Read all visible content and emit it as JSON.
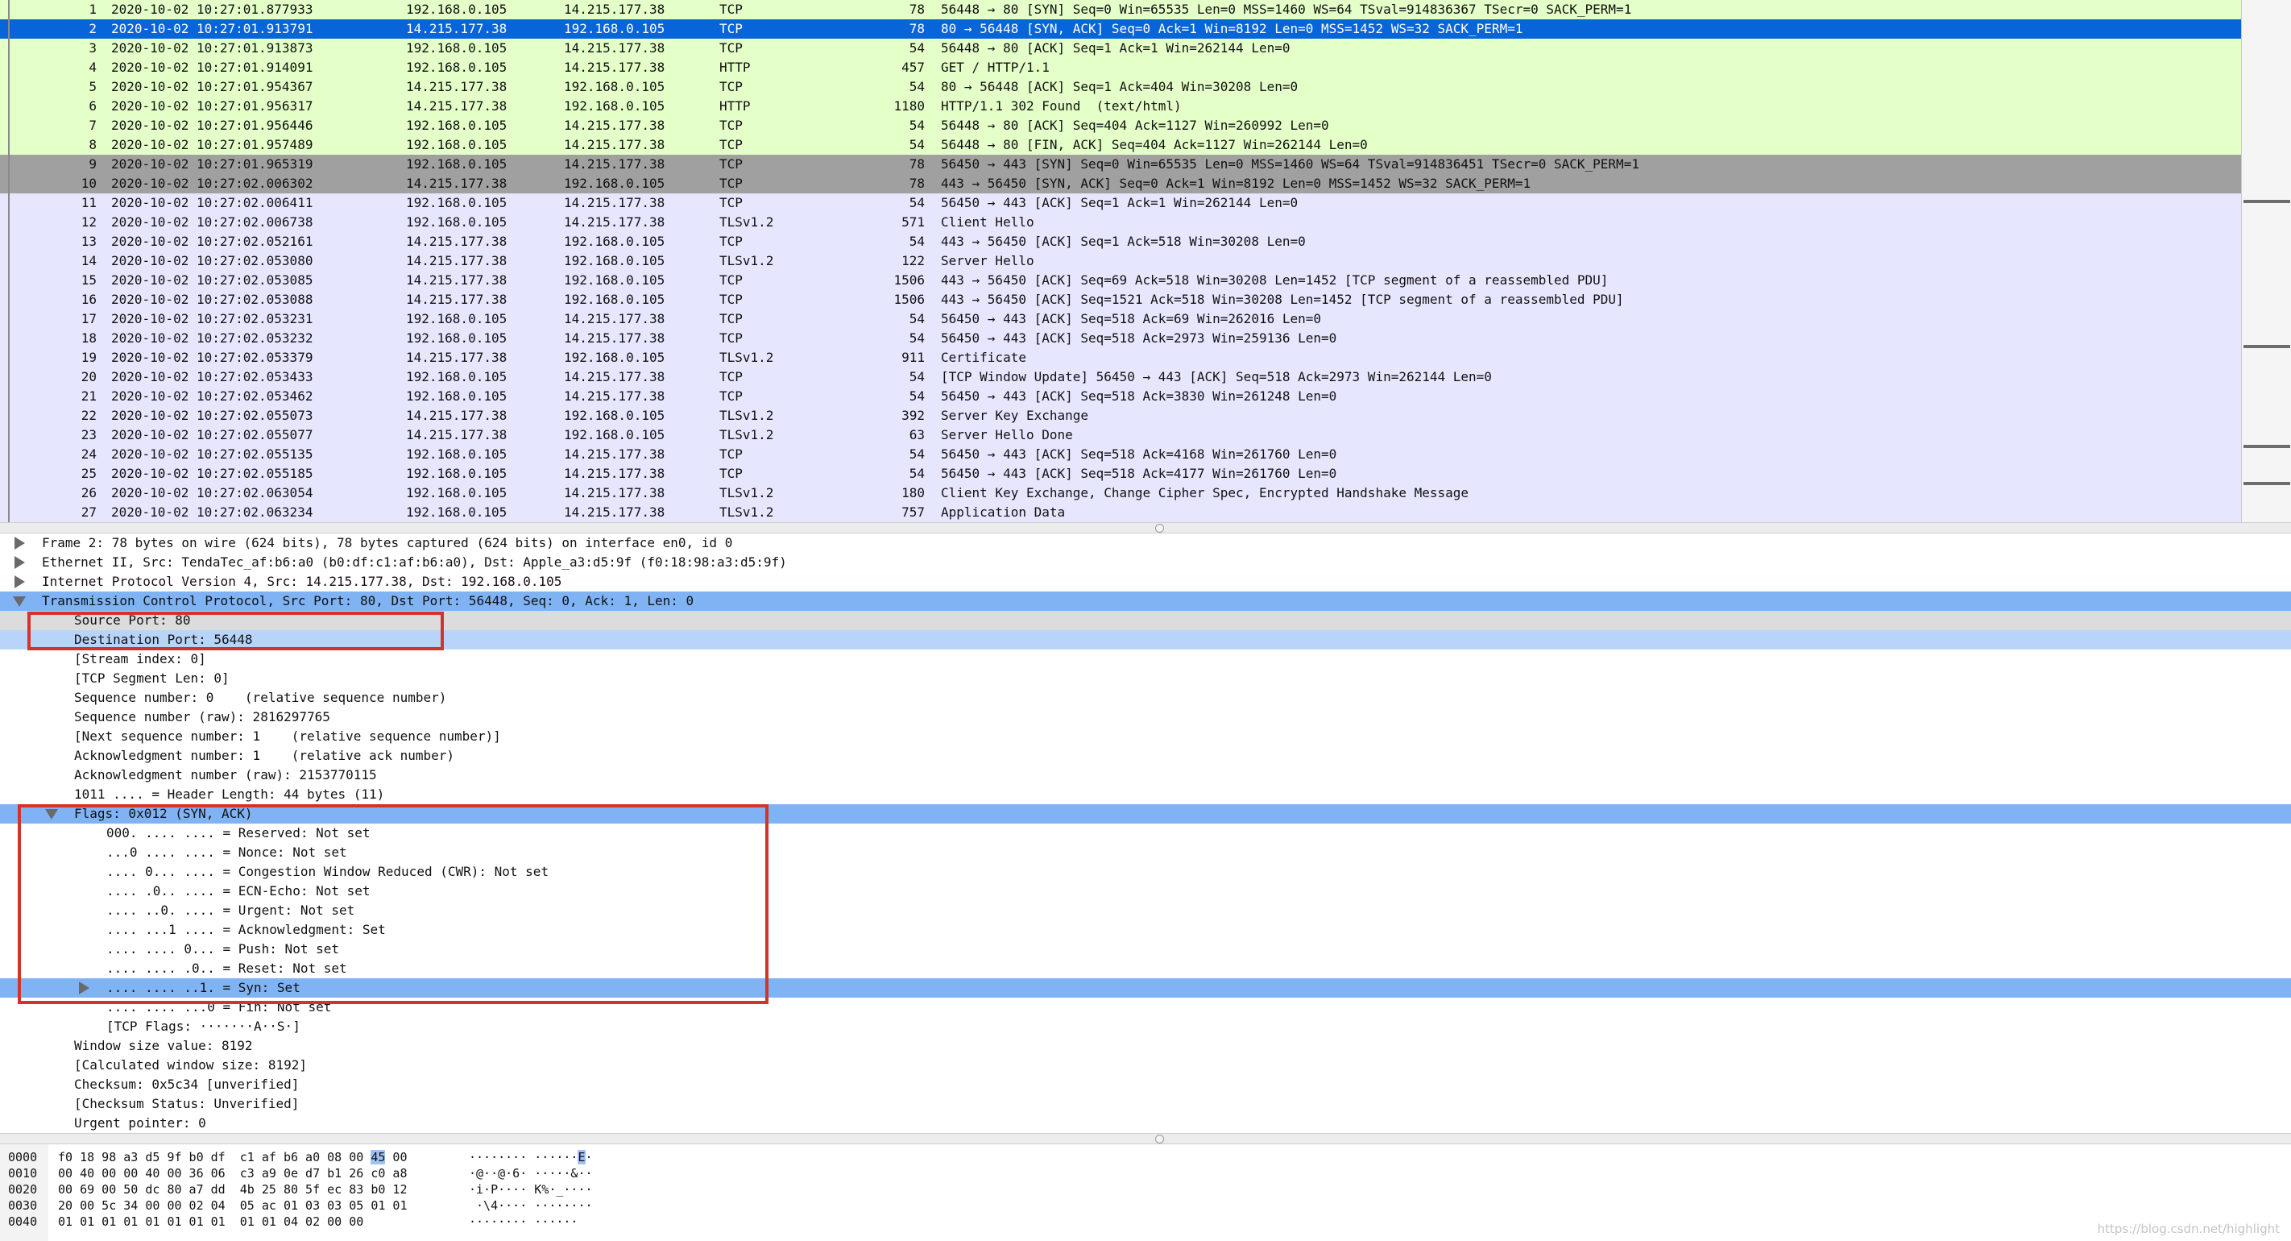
{
  "packets": [
    {
      "no": "1",
      "time": "2020-10-02 10:27:01.877933",
      "src": "192.168.0.105",
      "dst": "14.215.177.38",
      "proto": "TCP",
      "len": "78",
      "info": "56448 → 80 [SYN] Seq=0 Win=65535 Len=0 MSS=1460 WS=64 TSval=914836367 TSecr=0 SACK_PERM=1",
      "style": "green"
    },
    {
      "no": "2",
      "time": "2020-10-02 10:27:01.913791",
      "src": "14.215.177.38",
      "dst": "192.168.0.105",
      "proto": "TCP",
      "len": "78",
      "info": "80 → 56448 [SYN, ACK] Seq=0 Ack=1 Win=8192 Len=0 MSS=1452 WS=32 SACK_PERM=1",
      "style": "selected"
    },
    {
      "no": "3",
      "time": "2020-10-02 10:27:01.913873",
      "src": "192.168.0.105",
      "dst": "14.215.177.38",
      "proto": "TCP",
      "len": "54",
      "info": "56448 → 80 [ACK] Seq=1 Ack=1 Win=262144 Len=0",
      "style": "green"
    },
    {
      "no": "4",
      "time": "2020-10-02 10:27:01.914091",
      "src": "192.168.0.105",
      "dst": "14.215.177.38",
      "proto": "HTTP",
      "len": "457",
      "info": "GET / HTTP/1.1",
      "style": "green"
    },
    {
      "no": "5",
      "time": "2020-10-02 10:27:01.954367",
      "src": "14.215.177.38",
      "dst": "192.168.0.105",
      "proto": "TCP",
      "len": "54",
      "info": "80 → 56448 [ACK] Seq=1 Ack=404 Win=30208 Len=0",
      "style": "green"
    },
    {
      "no": "6",
      "time": "2020-10-02 10:27:01.956317",
      "src": "14.215.177.38",
      "dst": "192.168.0.105",
      "proto": "HTTP",
      "len": "1180",
      "info": "HTTP/1.1 302 Found  (text/html)",
      "style": "green"
    },
    {
      "no": "7",
      "time": "2020-10-02 10:27:01.956446",
      "src": "192.168.0.105",
      "dst": "14.215.177.38",
      "proto": "TCP",
      "len": "54",
      "info": "56448 → 80 [ACK] Seq=404 Ack=1127 Win=260992 Len=0",
      "style": "green"
    },
    {
      "no": "8",
      "time": "2020-10-02 10:27:01.957489",
      "src": "192.168.0.105",
      "dst": "14.215.177.38",
      "proto": "TCP",
      "len": "54",
      "info": "56448 → 80 [FIN, ACK] Seq=404 Ack=1127 Win=262144 Len=0",
      "style": "green"
    },
    {
      "no": "9",
      "time": "2020-10-02 10:27:01.965319",
      "src": "192.168.0.105",
      "dst": "14.215.177.38",
      "proto": "TCP",
      "len": "78",
      "info": "56450 → 443 [SYN] Seq=0 Win=65535 Len=0 MSS=1460 WS=64 TSval=914836451 TSecr=0 SACK_PERM=1",
      "style": "gray"
    },
    {
      "no": "10",
      "time": "2020-10-02 10:27:02.006302",
      "src": "14.215.177.38",
      "dst": "192.168.0.105",
      "proto": "TCP",
      "len": "78",
      "info": "443 → 56450 [SYN, ACK] Seq=0 Ack=1 Win=8192 Len=0 MSS=1452 WS=32 SACK_PERM=1",
      "style": "gray"
    },
    {
      "no": "11",
      "time": "2020-10-02 10:27:02.006411",
      "src": "192.168.0.105",
      "dst": "14.215.177.38",
      "proto": "TCP",
      "len": "54",
      "info": "56450 → 443 [ACK] Seq=1 Ack=1 Win=262144 Len=0",
      "style": "lav"
    },
    {
      "no": "12",
      "time": "2020-10-02 10:27:02.006738",
      "src": "192.168.0.105",
      "dst": "14.215.177.38",
      "proto": "TLSv1.2",
      "len": "571",
      "info": "Client Hello",
      "style": "lav"
    },
    {
      "no": "13",
      "time": "2020-10-02 10:27:02.052161",
      "src": "14.215.177.38",
      "dst": "192.168.0.105",
      "proto": "TCP",
      "len": "54",
      "info": "443 → 56450 [ACK] Seq=1 Ack=518 Win=30208 Len=0",
      "style": "lav"
    },
    {
      "no": "14",
      "time": "2020-10-02 10:27:02.053080",
      "src": "14.215.177.38",
      "dst": "192.168.0.105",
      "proto": "TLSv1.2",
      "len": "122",
      "info": "Server Hello",
      "style": "lav"
    },
    {
      "no": "15",
      "time": "2020-10-02 10:27:02.053085",
      "src": "14.215.177.38",
      "dst": "192.168.0.105",
      "proto": "TCP",
      "len": "1506",
      "info": "443 → 56450 [ACK] Seq=69 Ack=518 Win=30208 Len=1452 [TCP segment of a reassembled PDU]",
      "style": "lav"
    },
    {
      "no": "16",
      "time": "2020-10-02 10:27:02.053088",
      "src": "14.215.177.38",
      "dst": "192.168.0.105",
      "proto": "TCP",
      "len": "1506",
      "info": "443 → 56450 [ACK] Seq=1521 Ack=518 Win=30208 Len=1452 [TCP segment of a reassembled PDU]",
      "style": "lav"
    },
    {
      "no": "17",
      "time": "2020-10-02 10:27:02.053231",
      "src": "192.168.0.105",
      "dst": "14.215.177.38",
      "proto": "TCP",
      "len": "54",
      "info": "56450 → 443 [ACK] Seq=518 Ack=69 Win=262016 Len=0",
      "style": "lav"
    },
    {
      "no": "18",
      "time": "2020-10-02 10:27:02.053232",
      "src": "192.168.0.105",
      "dst": "14.215.177.38",
      "proto": "TCP",
      "len": "54",
      "info": "56450 → 443 [ACK] Seq=518 Ack=2973 Win=259136 Len=0",
      "style": "lav"
    },
    {
      "no": "19",
      "time": "2020-10-02 10:27:02.053379",
      "src": "14.215.177.38",
      "dst": "192.168.0.105",
      "proto": "TLSv1.2",
      "len": "911",
      "info": "Certificate",
      "style": "lav"
    },
    {
      "no": "20",
      "time": "2020-10-02 10:27:02.053433",
      "src": "192.168.0.105",
      "dst": "14.215.177.38",
      "proto": "TCP",
      "len": "54",
      "info": "[TCP Window Update] 56450 → 443 [ACK] Seq=518 Ack=2973 Win=262144 Len=0",
      "style": "lav"
    },
    {
      "no": "21",
      "time": "2020-10-02 10:27:02.053462",
      "src": "192.168.0.105",
      "dst": "14.215.177.38",
      "proto": "TCP",
      "len": "54",
      "info": "56450 → 443 [ACK] Seq=518 Ack=3830 Win=261248 Len=0",
      "style": "lav"
    },
    {
      "no": "22",
      "time": "2020-10-02 10:27:02.055073",
      "src": "14.215.177.38",
      "dst": "192.168.0.105",
      "proto": "TLSv1.2",
      "len": "392",
      "info": "Server Key Exchange",
      "style": "lav"
    },
    {
      "no": "23",
      "time": "2020-10-02 10:27:02.055077",
      "src": "14.215.177.38",
      "dst": "192.168.0.105",
      "proto": "TLSv1.2",
      "len": "63",
      "info": "Server Hello Done",
      "style": "lav"
    },
    {
      "no": "24",
      "time": "2020-10-02 10:27:02.055135",
      "src": "192.168.0.105",
      "dst": "14.215.177.38",
      "proto": "TCP",
      "len": "54",
      "info": "56450 → 443 [ACK] Seq=518 Ack=4168 Win=261760 Len=0",
      "style": "lav"
    },
    {
      "no": "25",
      "time": "2020-10-02 10:27:02.055185",
      "src": "192.168.0.105",
      "dst": "14.215.177.38",
      "proto": "TCP",
      "len": "54",
      "info": "56450 → 443 [ACK] Seq=518 Ack=4177 Win=261760 Len=0",
      "style": "lav"
    },
    {
      "no": "26",
      "time": "2020-10-02 10:27:02.063054",
      "src": "192.168.0.105",
      "dst": "14.215.177.38",
      "proto": "TLSv1.2",
      "len": "180",
      "info": "Client Key Exchange, Change Cipher Spec, Encrypted Handshake Message",
      "style": "lav"
    },
    {
      "no": "27",
      "time": "2020-10-02 10:27:02.063234",
      "src": "192.168.0.105",
      "dst": "14.215.177.38",
      "proto": "TLSv1.2",
      "len": "757",
      "info": "Application Data",
      "style": "lav"
    }
  ],
  "details": [
    {
      "text": "Frame 2: 78 bytes on wire (624 bits), 78 bytes captured (624 bits) on interface en0, id 0",
      "indent": 0,
      "expander": "collapsed",
      "style": ""
    },
    {
      "text": "Ethernet II, Src: TendaTec_af:b6:a0 (b0:df:c1:af:b6:a0), Dst: Apple_a3:d5:9f (f0:18:98:a3:d5:9f)",
      "indent": 0,
      "expander": "collapsed",
      "style": ""
    },
    {
      "text": "Internet Protocol Version 4, Src: 14.215.177.38, Dst: 192.168.0.105",
      "indent": 0,
      "expander": "collapsed",
      "style": ""
    },
    {
      "text": "Transmission Control Protocol, Src Port: 80, Dst Port: 56448, Seq: 0, Ack: 1, Len: 0",
      "indent": 0,
      "expander": "expanded",
      "style": "blue"
    },
    {
      "text": "Source Port: 80",
      "indent": 1,
      "expander": "",
      "style": "gray"
    },
    {
      "text": "Destination Port: 56448",
      "indent": 1,
      "expander": "",
      "style": "lightblue"
    },
    {
      "text": "[Stream index: 0]",
      "indent": 1,
      "expander": "",
      "style": ""
    },
    {
      "text": "[TCP Segment Len: 0]",
      "indent": 1,
      "expander": "",
      "style": ""
    },
    {
      "text": "Sequence number: 0    (relative sequence number)",
      "indent": 1,
      "expander": "",
      "style": ""
    },
    {
      "text": "Sequence number (raw): 2816297765",
      "indent": 1,
      "expander": "",
      "style": ""
    },
    {
      "text": "[Next sequence number: 1    (relative sequence number)]",
      "indent": 1,
      "expander": "",
      "style": ""
    },
    {
      "text": "Acknowledgment number: 1    (relative ack number)",
      "indent": 1,
      "expander": "",
      "style": ""
    },
    {
      "text": "Acknowledgment number (raw): 2153770115",
      "indent": 1,
      "expander": "",
      "style": ""
    },
    {
      "text": "1011 .... = Header Length: 44 bytes (11)",
      "indent": 1,
      "expander": "",
      "style": ""
    },
    {
      "text": "Flags: 0x012 (SYN, ACK)",
      "indent": 1,
      "expander": "expanded",
      "style": "blue"
    },
    {
      "text": "000. .... .... = Reserved: Not set",
      "indent": 2,
      "expander": "",
      "style": ""
    },
    {
      "text": "...0 .... .... = Nonce: Not set",
      "indent": 2,
      "expander": "",
      "style": ""
    },
    {
      "text": ".... 0... .... = Congestion Window Reduced (CWR): Not set",
      "indent": 2,
      "expander": "",
      "style": ""
    },
    {
      "text": ".... .0.. .... = ECN-Echo: Not set",
      "indent": 2,
      "expander": "",
      "style": ""
    },
    {
      "text": ".... ..0. .... = Urgent: Not set",
      "indent": 2,
      "expander": "",
      "style": ""
    },
    {
      "text": ".... ...1 .... = Acknowledgment: Set",
      "indent": 2,
      "expander": "",
      "style": ""
    },
    {
      "text": ".... .... 0... = Push: Not set",
      "indent": 2,
      "expander": "",
      "style": ""
    },
    {
      "text": ".... .... .0.. = Reset: Not set",
      "indent": 2,
      "expander": "",
      "style": ""
    },
    {
      "text": ".... .... ..1. = Syn: Set",
      "indent": 2,
      "expander": "collapsed",
      "style": "blue"
    },
    {
      "text": ".... .... ...0 = Fin: Not set",
      "indent": 2,
      "expander": "",
      "style": ""
    },
    {
      "text": "[TCP Flags: ·······A··S·]",
      "indent": 2,
      "expander": "",
      "style": ""
    },
    {
      "text": "Window size value: 8192",
      "indent": 1,
      "expander": "",
      "style": ""
    },
    {
      "text": "[Calculated window size: 8192]",
      "indent": 1,
      "expander": "",
      "style": ""
    },
    {
      "text": "Checksum: 0x5c34 [unverified]",
      "indent": 1,
      "expander": "",
      "style": ""
    },
    {
      "text": "[Checksum Status: Unverified]",
      "indent": 1,
      "expander": "",
      "style": ""
    },
    {
      "text": "Urgent pointer: 0",
      "indent": 1,
      "expander": "",
      "style": ""
    }
  ],
  "hex": [
    {
      "offset": "0000",
      "pre": "f0 18 98 a3 d5 9f b0 df  c1 af b6 a0 08 00 ",
      "hl": "45",
      "post": " 00",
      "ascii_pre": "········ ······",
      "ascii_hl": "E",
      "ascii_post": "·"
    },
    {
      "offset": "0010",
      "pre": "00 40 00 00 40 00 36 06  c3 a9 0e d7 b1 26 c0 a8",
      "hl": "",
      "post": "",
      "ascii_pre": "·@··@·6· ·····&··",
      "ascii_hl": "",
      "ascii_post": ""
    },
    {
      "offset": "0020",
      "pre": "00 69 00 50 dc 80 a7 dd  4b 25 80 5f ec 83 b0 12",
      "hl": "",
      "post": "",
      "ascii_pre": "·i·P···· K%·_····",
      "ascii_hl": "",
      "ascii_post": ""
    },
    {
      "offset": "0030",
      "pre": "20 00 5c 34 00 00 02 04  05 ac 01 03 03 05 01 01",
      "hl": "",
      "post": "",
      "ascii_pre": " ·\\4···· ········",
      "ascii_hl": "",
      "ascii_post": ""
    },
    {
      "offset": "0040",
      "pre": "01 01 01 01 01 01 01 01  01 01 04 02 00 00",
      "hl": "",
      "post": "",
      "ascii_pre": "········ ······",
      "ascii_hl": "",
      "ascii_post": ""
    }
  ],
  "watermark": "https://blog.csdn.net/highlight",
  "colors": {
    "row_green": "#e4ffc7",
    "row_gray": "#a0a0a0",
    "row_lavender": "#e7e6ff",
    "row_selected": "#0764d9",
    "detail_blue": "#7fb3f4",
    "detail_lightblue": "#b8d5f9",
    "annotation_red": "#d0342c"
  }
}
